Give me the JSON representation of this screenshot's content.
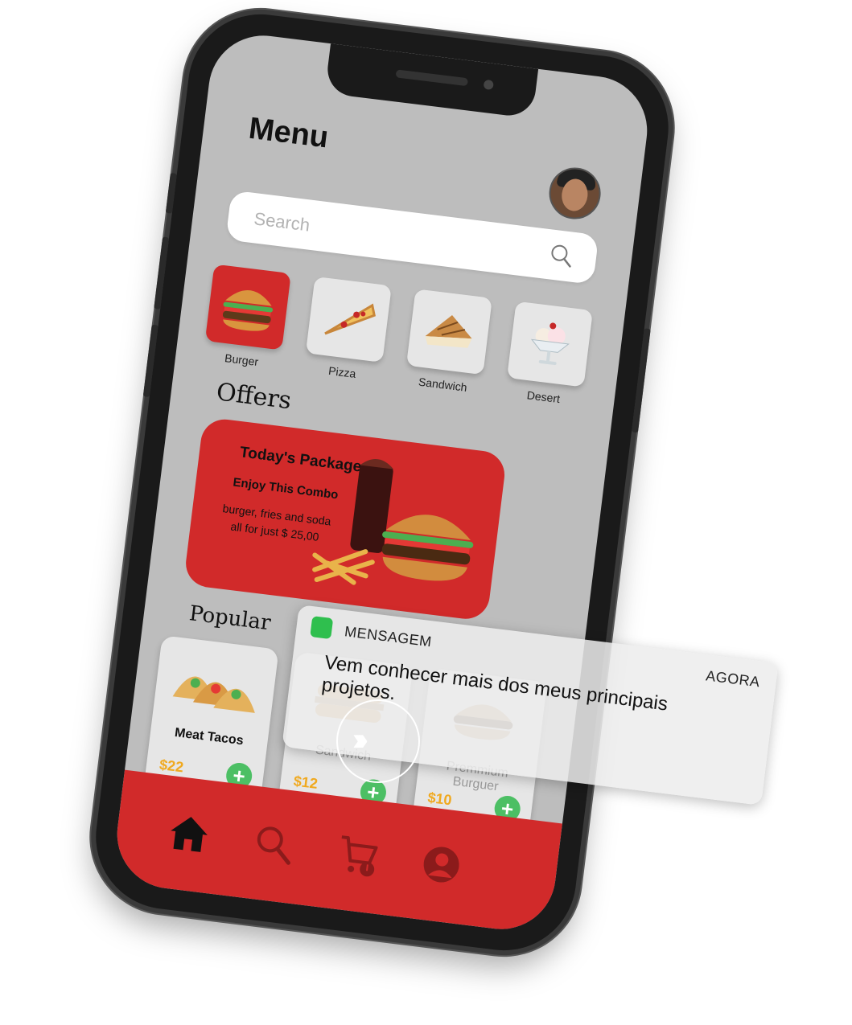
{
  "header": {
    "title": "Menu"
  },
  "search": {
    "placeholder": "Search"
  },
  "categories": [
    {
      "label": "Burger",
      "active": true
    },
    {
      "label": "Pizza",
      "active": false
    },
    {
      "label": "Sandwich",
      "active": false
    },
    {
      "label": "Desert",
      "active": false
    }
  ],
  "offers": {
    "section_title": "Offers",
    "title": "Today's Package",
    "subtitle": "Enjoy This Combo",
    "description": "burger, fries and soda all for just $ 25,00"
  },
  "popular": {
    "section_title": "Popular",
    "items": [
      {
        "name": "Meat Tacos",
        "price": "$22"
      },
      {
        "name": "Sandwich",
        "price": "$12"
      },
      {
        "name": "Premmium Burguer",
        "price": "$10"
      }
    ]
  },
  "notification": {
    "app": "MENSAGEM",
    "time": "AGORA",
    "message": "Vem conhecer mais dos meus principais projetos."
  },
  "nav": [
    "home-icon",
    "search-icon",
    "cart-icon",
    "profile-icon"
  ],
  "colors": {
    "accent": "#d12a2a",
    "screen_bg": "#bdbdbd",
    "price": "#f0a91f",
    "add": "#4cbf64"
  }
}
